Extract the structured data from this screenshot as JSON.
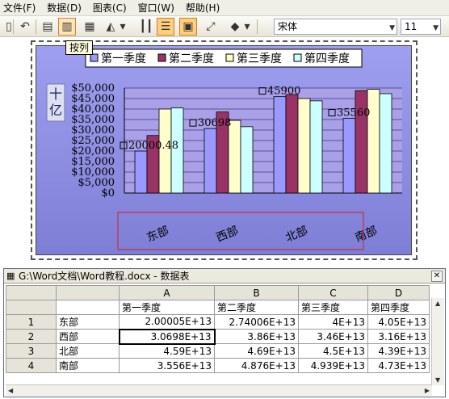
{
  "menu": [
    "文件(F)",
    "数据(D)",
    "图表(C)",
    "窗口(W)",
    "帮助(H)"
  ],
  "toolbar": {
    "icons": [
      "page-icon",
      "undo-icon",
      "by-row-icon",
      "by-column-icon",
      "data-table-icon",
      "chart-type-icon",
      "category-axis-gridlines-icon",
      "value-axis-gridlines-icon",
      "legend-icon",
      "text-direction-icon",
      "fill-color-icon"
    ],
    "font": "宋体",
    "size": "11",
    "tooltip": "按列"
  },
  "chart_data": {
    "type": "bar",
    "categories": [
      "东部",
      "西部",
      "北部",
      "南部"
    ],
    "series": [
      {
        "name": "第一季度",
        "values": [
          20000.48,
          30698,
          45900,
          35560
        ]
      },
      {
        "name": "第二季度",
        "values": [
          27400.6,
          38600,
          46900,
          48760
        ]
      },
      {
        "name": "第三季度",
        "values": [
          40000,
          34600,
          45000,
          49390
        ]
      },
      {
        "name": "第四季度",
        "values": [
          40500,
          31600,
          43900,
          47300
        ]
      }
    ],
    "colors": [
      "#9999ff",
      "#993366",
      "#ffffcc",
      "#ccffff"
    ],
    "ylabel": "十亿",
    "yticks": [
      "$0",
      "$5,000",
      "$10,000",
      "$15,000",
      "$20,000",
      "$25,000",
      "$30,000",
      "$35,000",
      "$40,000",
      "$45,000",
      "$50,000"
    ],
    "ylim": [
      0,
      50000
    ],
    "data_labels": [
      "20000.48",
      "30698",
      "45900",
      "35560"
    ],
    "legend": "top",
    "grid": true
  },
  "sheet": {
    "title": "G:\\Word文档\\Word教程.docx - 数据表",
    "col_letters": [
      "A",
      "B",
      "C",
      "D"
    ],
    "col_headers": [
      "第一季度",
      "第二季度",
      "第三季度",
      "第四季度"
    ],
    "rows": [
      {
        "num": "1",
        "label": "东部",
        "values": [
          "2.00005E+13",
          "2.74006E+13",
          "4E+13",
          "4.05E+13"
        ]
      },
      {
        "num": "2",
        "label": "西部",
        "values": [
          "3.0698E+13",
          "3.86E+13",
          "3.46E+13",
          "3.16E+13"
        ]
      },
      {
        "num": "3",
        "label": "北部",
        "values": [
          "4.59E+13",
          "4.69E+13",
          "4.5E+13",
          "4.39E+13"
        ]
      },
      {
        "num": "4",
        "label": "南部",
        "values": [
          "3.556E+13",
          "4.876E+13",
          "4.939E+13",
          "4.73E+13"
        ]
      }
    ]
  }
}
